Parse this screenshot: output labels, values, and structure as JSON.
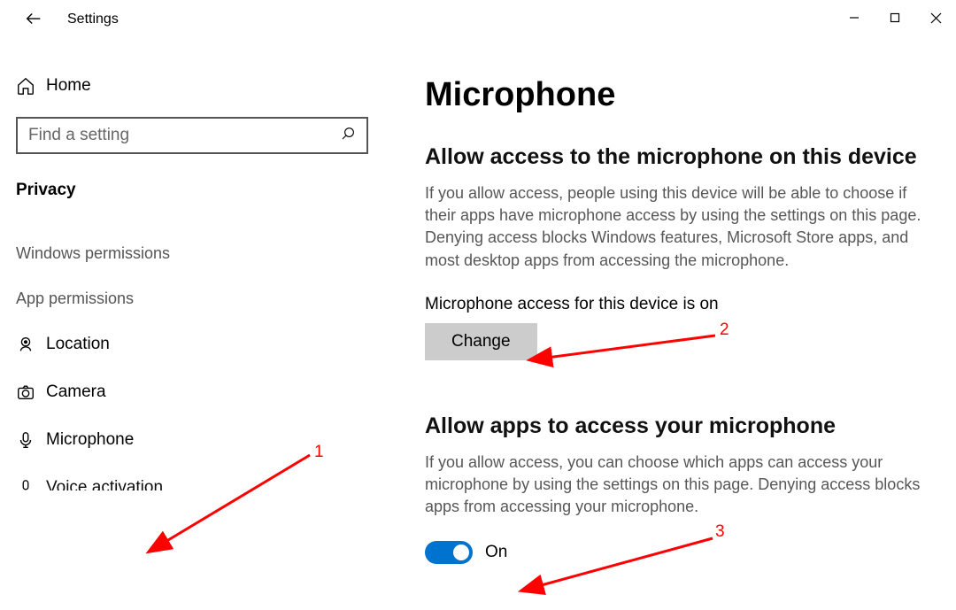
{
  "windowTitle": "Settings",
  "search": {
    "placeholder": "Find a setting"
  },
  "sidebar": {
    "home": "Home",
    "category": "Privacy",
    "group1": "Windows permissions",
    "group2": "App permissions",
    "items": {
      "location": "Location",
      "camera": "Camera",
      "microphone": "Microphone",
      "voice": "Voice activation"
    }
  },
  "main": {
    "title": "Microphone",
    "section1": {
      "heading": "Allow access to the microphone on this device",
      "desc": "If you allow access, people using this device will be able to choose if their apps have microphone access by using the settings on this page. Denying access blocks Windows features, Microsoft Store apps, and most desktop apps from accessing the microphone.",
      "status": "Microphone access for this device is on",
      "button": "Change"
    },
    "section2": {
      "heading": "Allow apps to access your microphone",
      "desc": "If you allow access, you can choose which apps can access your microphone by using the settings on this page. Denying access blocks apps from accessing your microphone.",
      "toggleLabel": "On"
    }
  },
  "annotations": {
    "a1": "1",
    "a2": "2",
    "a3": "3"
  }
}
